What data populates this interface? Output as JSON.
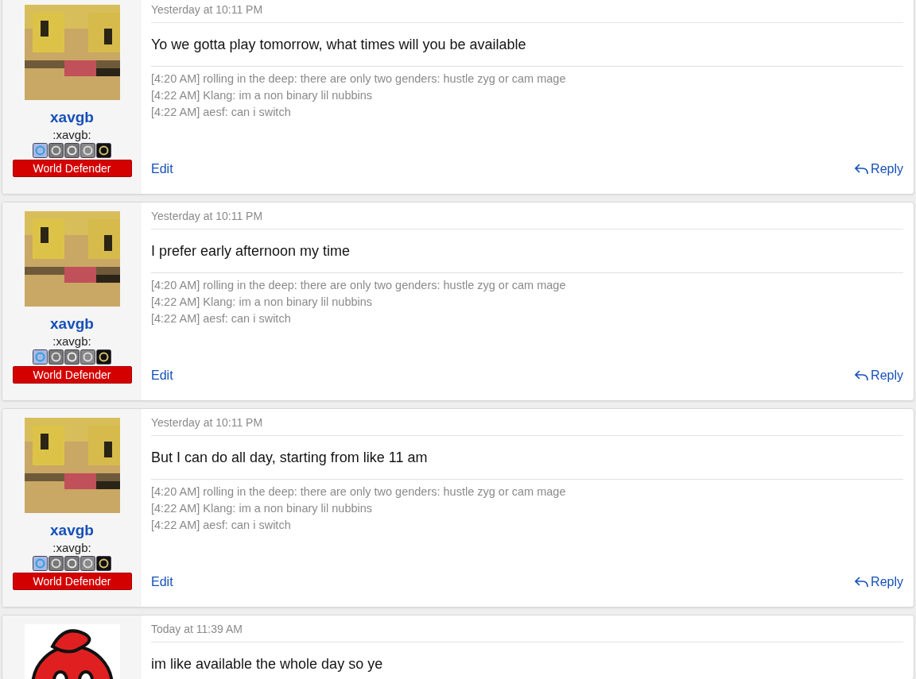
{
  "posts": [
    {
      "avatar": {
        "kind": "pixel"
      },
      "username": "xavgb",
      "user_title": ":xavgb:",
      "rank": "World Defender",
      "timestamp": "Yesterday at 10:11 PM",
      "message": "Yo we gotta play tomorrow, what times will you be available",
      "signature": [
        "[4:20 AM] rolling in the deep: there are only two genders: hustle zyg or cam mage",
        "[4:22 AM] Klang: im a non binary lil nubbins",
        "[4:22 AM] aesf: can i switch"
      ],
      "actions": {
        "edit": "Edit",
        "reply": "Reply"
      }
    },
    {
      "avatar": {
        "kind": "pixel"
      },
      "username": "xavgb",
      "user_title": ":xavgb:",
      "rank": "World Defender",
      "timestamp": "Yesterday at 10:11 PM",
      "message": "I prefer early afternoon my time",
      "signature": [
        "[4:20 AM] rolling in the deep: there are only two genders: hustle zyg or cam mage",
        "[4:22 AM] Klang: im a non binary lil nubbins",
        "[4:22 AM] aesf: can i switch"
      ],
      "actions": {
        "edit": "Edit",
        "reply": "Reply"
      }
    },
    {
      "avatar": {
        "kind": "pixel"
      },
      "username": "xavgb",
      "user_title": ":xavgb:",
      "rank": "World Defender",
      "timestamp": "Yesterday at 10:11 PM",
      "message": "But I can do all day, starting from like 11 am",
      "signature": [
        "[4:20 AM] rolling in the deep: there are only two genders: hustle zyg or cam mage",
        "[4:22 AM] Klang: im a non binary lil nubbins",
        "[4:22 AM] aesf: can i switch"
      ],
      "actions": {
        "edit": "Edit",
        "reply": "Reply"
      }
    },
    {
      "avatar": {
        "kind": "ball"
      },
      "timestamp": "Today at 11:39 AM",
      "message": "im like available the whole day so ye"
    }
  ]
}
